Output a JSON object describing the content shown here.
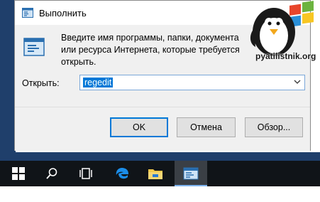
{
  "dialog": {
    "title": "Выполнить",
    "description": "Введите имя программы, папки, документа или ресурса Интернета, которые требуется открыть.",
    "open_label": "Открыть:",
    "open_value": "regedit",
    "buttons": {
      "ok": "OK",
      "cancel": "Отмена",
      "browse": "Обзор..."
    }
  },
  "taskbar": {
    "items": [
      "windows-start",
      "search",
      "task-view",
      "edge",
      "file-explorer",
      "run"
    ]
  },
  "watermark": {
    "text": "pyatilistnik.org"
  },
  "colors": {
    "accent": "#0078d7",
    "taskbar": "#101418",
    "desktop": "#1f3f6b"
  }
}
